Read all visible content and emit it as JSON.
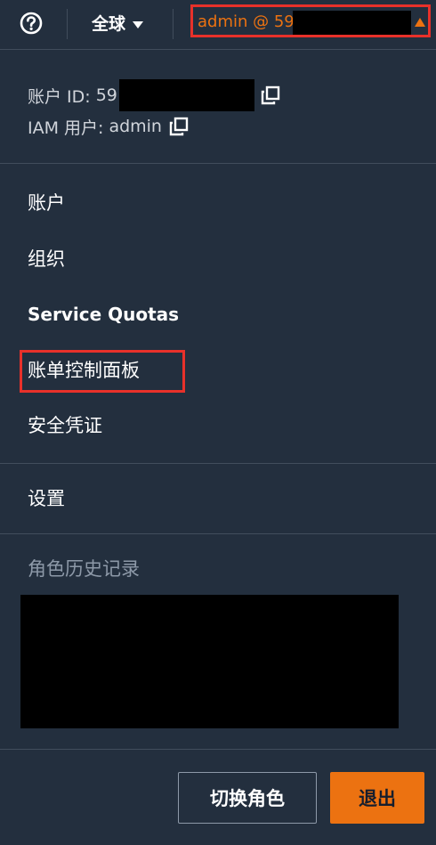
{
  "topbar": {
    "help_icon": "help-circle-icon",
    "region_label": "全球",
    "region_caret_icon": "caret-down-icon",
    "account_label": "admin @ 59",
    "account_caret_icon": "caret-up-icon"
  },
  "account_info": {
    "account_id_label": "账户 ID:",
    "account_id_prefix": "59",
    "iam_user_label": "IAM 用户:",
    "iam_user_value": "admin",
    "copy_icon": "copy-icon"
  },
  "menu": {
    "items": [
      {
        "label": "账户"
      },
      {
        "label": "组织"
      },
      {
        "label": "Service Quotas"
      },
      {
        "label": "账单控制面板"
      },
      {
        "label": "安全凭证"
      }
    ],
    "settings_label": "设置"
  },
  "role_history": {
    "heading": "角色历史记录"
  },
  "footer": {
    "switch_role_label": "切换角色",
    "sign_out_label": "退出"
  },
  "colors": {
    "background": "#232f3e",
    "divider": "#414d5c",
    "accent_orange": "#ec7211",
    "highlight_red": "#e8312a",
    "muted_text": "#8d99a8"
  }
}
